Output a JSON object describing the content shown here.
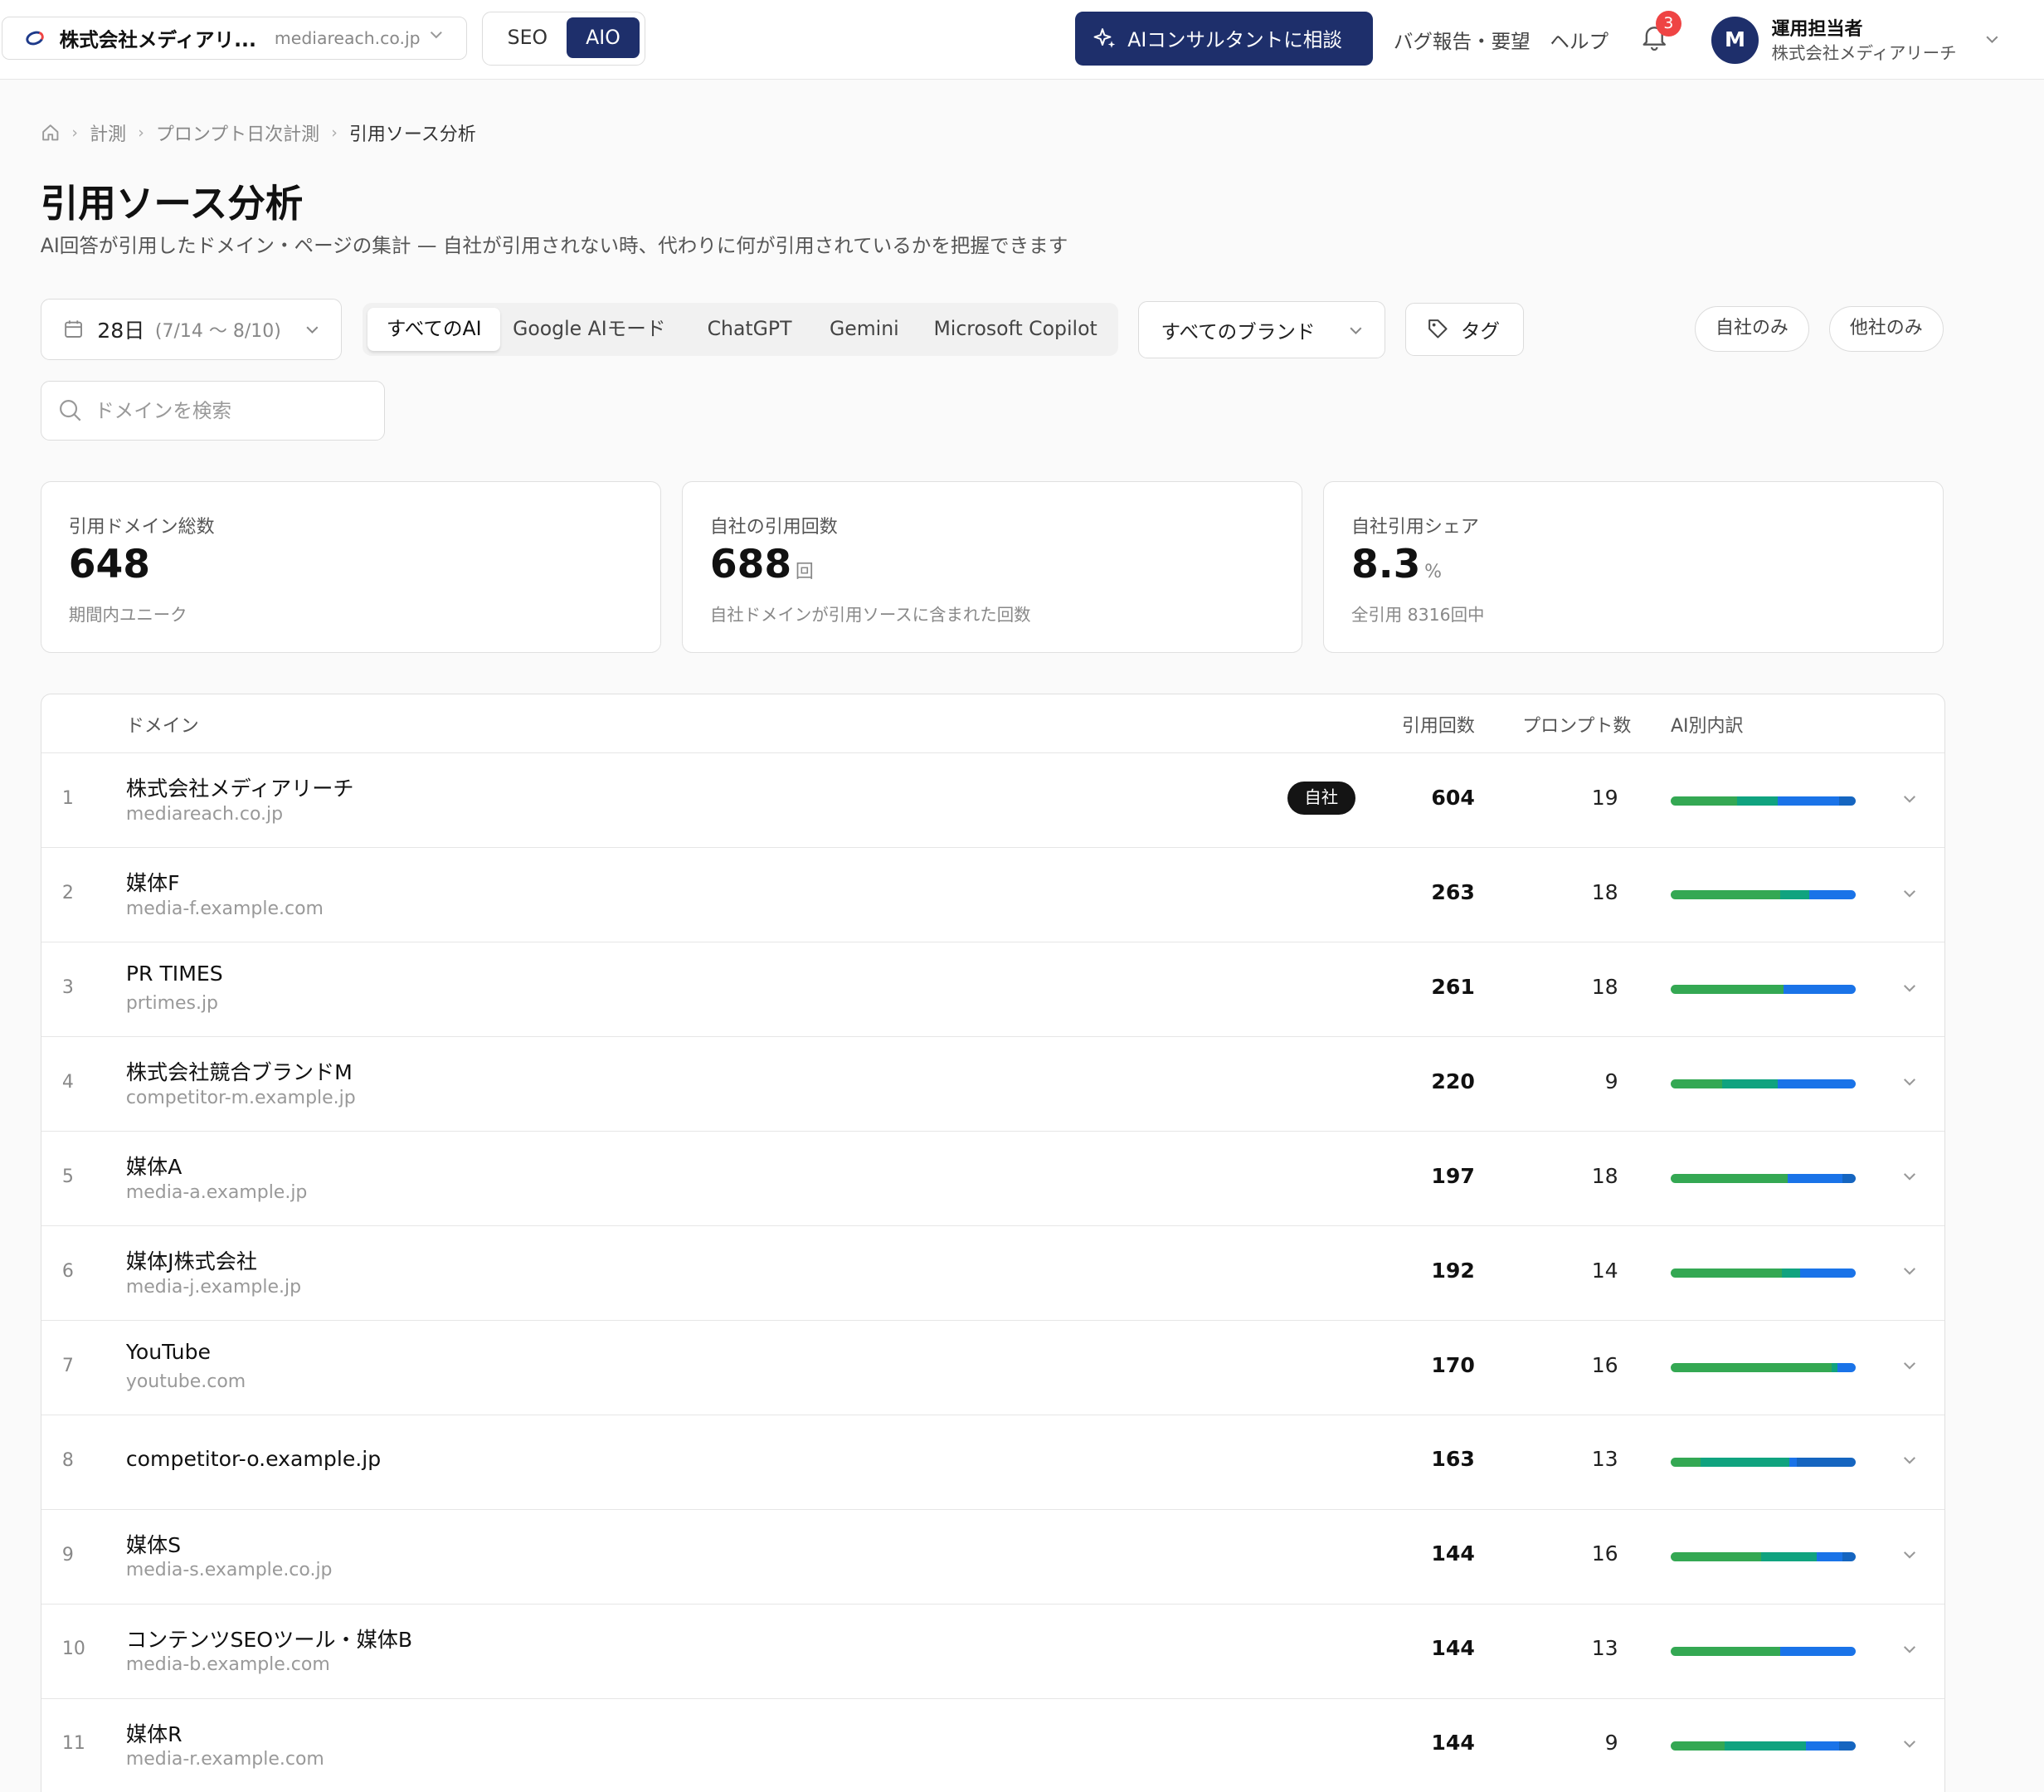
{
  "header": {
    "workspace_name": "株式会社メディアリ...",
    "workspace_domain": "mediareach.co.jp",
    "seg_seo": "SEO",
    "seg_aio": "AIO",
    "consult_label": "AIコンサルタントに相談",
    "bug_report": "バグ報告・要望",
    "help": "ヘルプ",
    "notification_count": "3",
    "avatar_initial": "M",
    "user_name": "運用担当者",
    "user_org": "株式会社メディアリーチ"
  },
  "breadcrumb": [
    "計測",
    "プロンプト日次計測",
    "引用ソース分析"
  ],
  "page": {
    "title": "引用ソース分析",
    "subtitle": "AI回答が引用したドメイン・ページの集計 — 自社が引用されない時、代わりに何が引用されているかを把握できます"
  },
  "filters": {
    "date_days": "28日",
    "date_range": "(7/14 〜 8/10)",
    "ai_tabs": [
      "すべてのAI",
      "Google AIモード",
      "ChatGPT",
      "Gemini",
      "Microsoft Copilot"
    ],
    "brand_select": "すべてのブランド",
    "tag_label": "タグ",
    "own_only": "自社のみ",
    "others_only": "他社のみ",
    "search_placeholder": "ドメインを検索"
  },
  "kpis": [
    {
      "label": "引用ドメイン総数",
      "value": "648",
      "unit": "",
      "note": "期間内ユニーク"
    },
    {
      "label": "自社の引用回数",
      "value": "688",
      "unit": "回",
      "note": "自社ドメインが引用ソースに含まれた回数"
    },
    {
      "label": "自社引用シェア",
      "value": "8.3",
      "unit": "%",
      "note": "全引用 8316回中"
    }
  ],
  "table": {
    "headers": {
      "domain": "ドメイン",
      "citations": "引用回数",
      "prompts": "プロンプト数",
      "ai_breakdown": "AI別内訳"
    },
    "own_badge": "自社",
    "ai_colors": [
      "#34a853",
      "#10a37f",
      "#1a73e8",
      "#1565c0"
    ],
    "rows": [
      {
        "rank": "1",
        "name": "株式会社メディアリーチ",
        "domain": "mediareach.co.jp",
        "own": true,
        "citations": "604",
        "prompts": "19",
        "split": [
          0.36,
          0.22,
          0.33,
          0.09
        ]
      },
      {
        "rank": "2",
        "name": "媒体F",
        "domain": "media-f.example.com",
        "own": false,
        "citations": "263",
        "prompts": "18",
        "split": [
          0.59,
          0.16,
          0.25,
          0.0
        ]
      },
      {
        "rank": "3",
        "name": "PR TIMES",
        "domain": "prtimes.jp",
        "own": false,
        "citations": "261",
        "prompts": "18",
        "split": [
          0.61,
          0.0,
          0.39,
          0.0
        ]
      },
      {
        "rank": "4",
        "name": "株式会社競合ブランドM",
        "domain": "competitor-m.example.jp",
        "own": false,
        "citations": "220",
        "prompts": "9",
        "split": [
          0.28,
          0.3,
          0.42,
          0.0
        ]
      },
      {
        "rank": "5",
        "name": "媒体A",
        "domain": "media-a.example.jp",
        "own": false,
        "citations": "197",
        "prompts": "18",
        "split": [
          0.63,
          0.0,
          0.3,
          0.07
        ]
      },
      {
        "rank": "6",
        "name": "媒体J株式会社",
        "domain": "media-j.example.jp",
        "own": false,
        "citations": "192",
        "prompts": "14",
        "split": [
          0.6,
          0.1,
          0.3,
          0.0
        ]
      },
      {
        "rank": "7",
        "name": "YouTube",
        "domain": "youtube.com",
        "own": false,
        "citations": "170",
        "prompts": "16",
        "split": [
          0.87,
          0.03,
          0.1,
          0.0
        ]
      },
      {
        "rank": "8",
        "name": "competitor-o.example.jp",
        "domain": "",
        "own": false,
        "citations": "163",
        "prompts": "13",
        "split": [
          0.16,
          0.48,
          0.04,
          0.32
        ]
      },
      {
        "rank": "9",
        "name": "媒体S",
        "domain": "media-s.example.co.jp",
        "own": false,
        "citations": "144",
        "prompts": "16",
        "split": [
          0.49,
          0.3,
          0.14,
          0.07
        ]
      },
      {
        "rank": "10",
        "name": "コンテンツSEOツール・媒体B",
        "domain": "media-b.example.com",
        "own": false,
        "citations": "144",
        "prompts": "13",
        "split": [
          0.59,
          0.0,
          0.41,
          0.0
        ]
      },
      {
        "rank": "11",
        "name": "媒体R",
        "domain": "media-r.example.com",
        "own": false,
        "citations": "144",
        "prompts": "9",
        "split": [
          0.29,
          0.44,
          0.18,
          0.09
        ]
      }
    ]
  }
}
